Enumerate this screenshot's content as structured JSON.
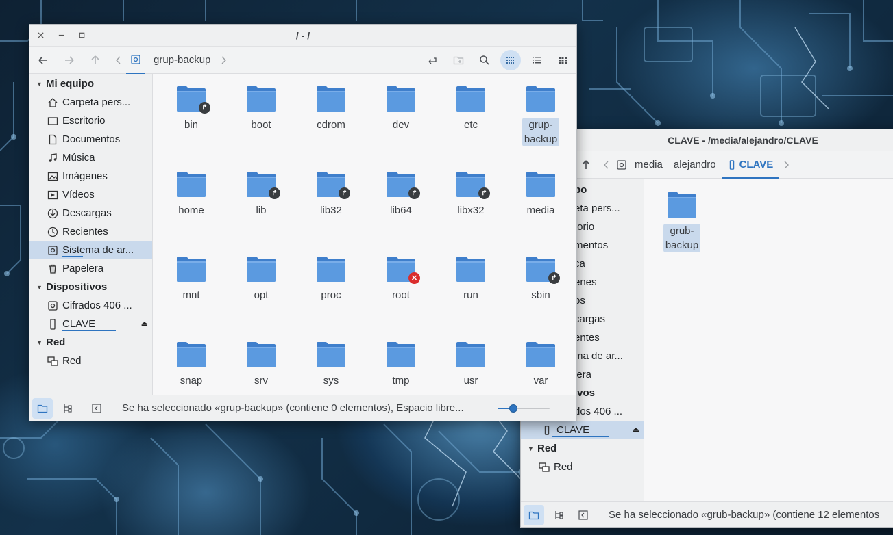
{
  "window_main": {
    "title": "/ - /",
    "breadcrumb": {
      "current": "grup-backup"
    },
    "sidebar": {
      "sections": [
        {
          "label": "Mi equipo",
          "items": [
            {
              "label": "Carpeta pers...",
              "icon": "home-icon"
            },
            {
              "label": "Escritorio",
              "icon": "desktop-icon"
            },
            {
              "label": "Documentos",
              "icon": "document-icon"
            },
            {
              "label": "Música",
              "icon": "music-icon"
            },
            {
              "label": "Imágenes",
              "icon": "image-icon"
            },
            {
              "label": "Vídeos",
              "icon": "video-icon"
            },
            {
              "label": "Descargas",
              "icon": "download-icon"
            },
            {
              "label": "Recientes",
              "icon": "clock-icon"
            },
            {
              "label": "Sistema de ar...",
              "icon": "disk-icon",
              "selected": true
            },
            {
              "label": "Papelera",
              "icon": "trash-icon"
            }
          ]
        },
        {
          "label": "Dispositivos",
          "items": [
            {
              "label": "Cifrados 406 ...",
              "icon": "disk-icon"
            },
            {
              "label": "CLAVE",
              "icon": "usb-drive-icon",
              "eject": true
            }
          ]
        },
        {
          "label": "Red",
          "items": [
            {
              "label": "Red",
              "icon": "network-icon"
            }
          ]
        }
      ]
    },
    "files": [
      {
        "name": "bin",
        "badge": "link"
      },
      {
        "name": "boot"
      },
      {
        "name": "cdrom"
      },
      {
        "name": "dev"
      },
      {
        "name": "etc"
      },
      {
        "name": "grup-\nbackup",
        "selected": true
      },
      {
        "name": "home"
      },
      {
        "name": "lib",
        "badge": "link"
      },
      {
        "name": "lib32",
        "badge": "link"
      },
      {
        "name": "lib64",
        "badge": "link"
      },
      {
        "name": "libx32",
        "badge": "link"
      },
      {
        "name": "media"
      },
      {
        "name": "mnt"
      },
      {
        "name": "opt"
      },
      {
        "name": "proc"
      },
      {
        "name": "root",
        "badge": "lock"
      },
      {
        "name": "run"
      },
      {
        "name": "sbin",
        "badge": "link"
      },
      {
        "name": "snap"
      },
      {
        "name": "srv"
      },
      {
        "name": "sys"
      },
      {
        "name": "tmp"
      },
      {
        "name": "usr"
      },
      {
        "name": "var"
      }
    ],
    "status": "Se ha seleccionado «grup-backup» (contiene 0 elementos), Espacio libre...",
    "zoom_level": 0.3
  },
  "window_second": {
    "title": "CLAVE - /media/alejandro/CLAVE",
    "breadcrumb": [
      "media",
      "alejandro",
      "CLAVE"
    ],
    "sidebar_visible": [
      {
        "label": "po",
        "type": "head"
      },
      {
        "label": "eta pers...",
        "type": "item"
      },
      {
        "label": "torio",
        "type": "item"
      },
      {
        "label": "mentos",
        "type": "item"
      },
      {
        "label": "ca",
        "type": "item"
      },
      {
        "label": "enes",
        "type": "item"
      },
      {
        "label": "os",
        "type": "item"
      },
      {
        "label": "cargas",
        "type": "item"
      },
      {
        "label": "entes",
        "type": "item"
      },
      {
        "label": "ma de ar...",
        "type": "item"
      },
      {
        "label": "lera",
        "type": "item"
      },
      {
        "label": "ivos",
        "type": "head"
      },
      {
        "label": "dos 406 ...",
        "type": "item"
      }
    ],
    "sidebar_devices": {
      "clave": "CLAVE",
      "red_head": "Red",
      "red_item": "Red"
    },
    "files": [
      {
        "name": "grub-\nbackup",
        "selected": true
      }
    ],
    "status": "Se ha seleccionado «grub-backup» (contiene 12 elementos"
  },
  "colors": {
    "folder": "#5b9ae0",
    "folder_dark": "#3f7fcc",
    "accent": "#2e74c0",
    "selection": "#c9d9ec"
  }
}
